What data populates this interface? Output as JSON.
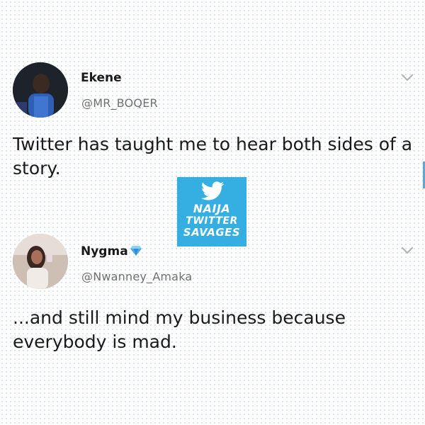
{
  "tweets": [
    {
      "display_name": "Ekene",
      "handle": "@MR_BOQER",
      "text": "Twitter has taught me to hear both sides of a story.",
      "avatar": "profile-photo"
    },
    {
      "display_name": "Nygma",
      "handle": "@Nwanney_Amaka",
      "text": "...and still mind my business because everybody is mad.",
      "avatar": "profile-photo",
      "name_badge": "blue-diamond-icon"
    }
  ],
  "watermark": {
    "icon": "twitter-bird-icon",
    "line1": "NAIJA",
    "line2": "TWITTER",
    "line3": "SAVAGES",
    "background": "#35aee2"
  },
  "colors": {
    "text": "#1a1a1a",
    "handle": "#707070",
    "accent": "#35aee2"
  }
}
